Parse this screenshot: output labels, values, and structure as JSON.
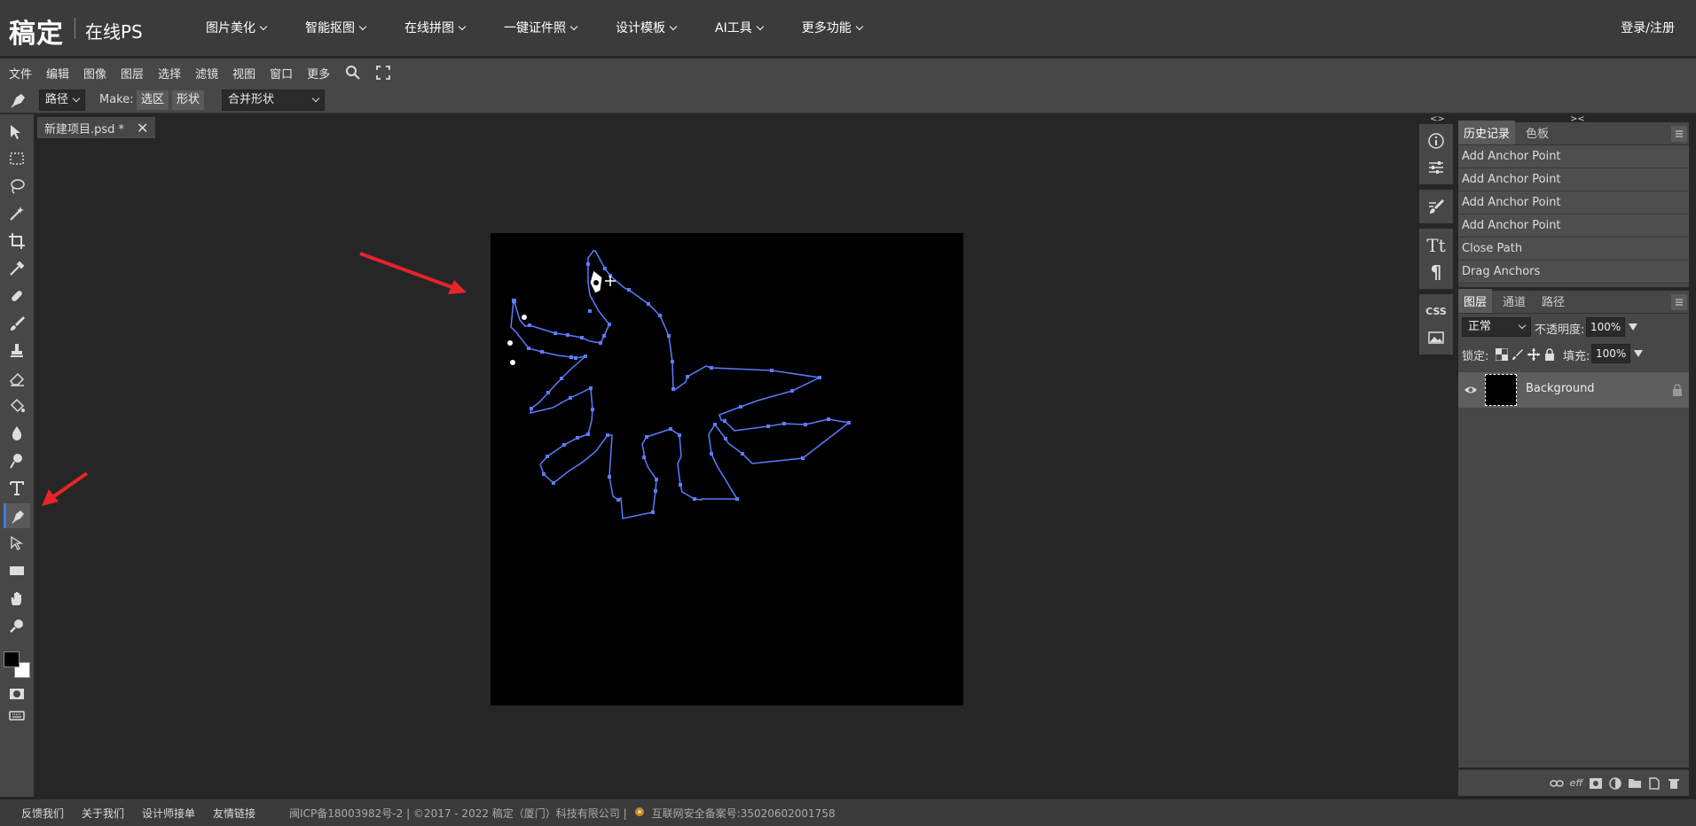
{
  "header": {
    "logo": "稿定",
    "logo_sub": "在线PS",
    "nav": [
      {
        "label": "图片美化"
      },
      {
        "label": "智能抠图"
      },
      {
        "label": "在线拼图"
      },
      {
        "label": "一键证件照"
      },
      {
        "label": "设计模板"
      },
      {
        "label": "AI工具"
      },
      {
        "label": "更多功能"
      }
    ],
    "login": "登录/注册"
  },
  "menubar": {
    "items": [
      "文件",
      "编辑",
      "图像",
      "图层",
      "选择",
      "滤镜",
      "视图",
      "窗口",
      "更多"
    ]
  },
  "options": {
    "mode_value": "路径",
    "make_label": "Make:",
    "selection_btn": "选区",
    "shape_btn": "形状",
    "combine_value": "合并形状"
  },
  "document": {
    "tab_title": "新建项目.psd *",
    "close_glyph": "✕"
  },
  "history": {
    "tabs": [
      "历史记录",
      "色板"
    ],
    "items": [
      "Add Anchor Point",
      "Add Anchor Point",
      "Add Anchor Point",
      "Add Anchor Point",
      "Close Path",
      "Drag Anchors"
    ]
  },
  "layers": {
    "tabs": [
      "图层",
      "通道",
      "路径"
    ],
    "blend_mode": "正常",
    "opacity_label": "不透明度:",
    "opacity_value": "100%",
    "lock_label": "锁定:",
    "fill_label": "填充:",
    "fill_value": "100%",
    "layer_name": "Background"
  },
  "midcol": {
    "css_label": "CSS",
    "tt_label": "Tt",
    "para_label": "¶"
  },
  "footer": {
    "links": [
      "反馈我们",
      "关于我们",
      "设计师接单",
      "友情链接"
    ],
    "icp": "闽ICP备18003982号-2 | ©2017 - 2022 稿定（厦门）科技有限公司 |",
    "police": "互联网安全备案号:35020602001758"
  },
  "colors": {
    "accent": "#3b7de0",
    "path": "#5b7cff",
    "arrow": "#e8232a"
  }
}
